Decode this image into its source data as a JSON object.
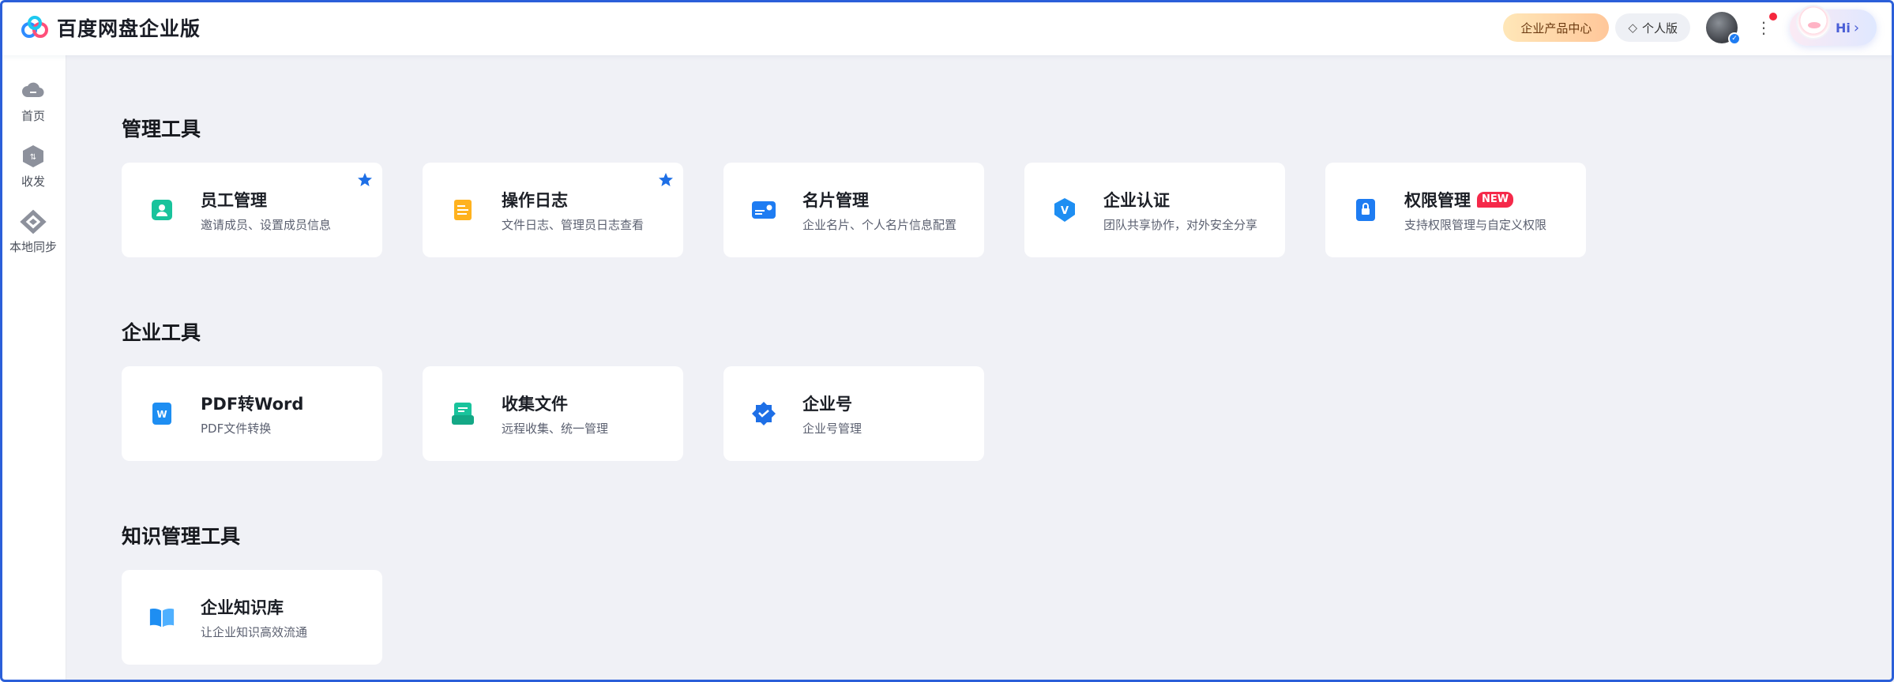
{
  "header": {
    "brand": "百度网盘企业版",
    "product_center": "企业产品中心",
    "personal_version": "个人版",
    "hi": "Hi"
  },
  "sidebar": {
    "items": [
      {
        "label": "首页",
        "icon": "cloud-icon"
      },
      {
        "label": "收发",
        "icon": "transfer-icon"
      },
      {
        "label": "本地同步",
        "icon": "sync-icon"
      }
    ]
  },
  "sections": [
    {
      "title": "管理工具",
      "cards": [
        {
          "title": "员工管理",
          "desc": "邀请成员、设置成员信息",
          "starred": true,
          "icon": "employee-icon",
          "color": "#19c39c"
        },
        {
          "title": "操作日志",
          "desc": "文件日志、管理员日志查看",
          "starred": true,
          "icon": "log-icon",
          "color": "#ffb21e"
        },
        {
          "title": "名片管理",
          "desc": "企业名片、个人名片信息配置",
          "starred": false,
          "icon": "card-icon",
          "color": "#1e7cf2"
        },
        {
          "title": "企业认证",
          "desc": "团队共享协作，对外安全分享",
          "starred": false,
          "icon": "verify-icon",
          "color": "#1e8ef2"
        },
        {
          "title": "权限管理",
          "desc": "支持权限管理与自定义权限",
          "starred": false,
          "icon": "lock-icon",
          "color": "#1e7cf2",
          "badge": "NEW"
        }
      ]
    },
    {
      "title": "企业工具",
      "cards": [
        {
          "title": "PDF转Word",
          "desc": "PDF文件转换",
          "starred": false,
          "icon": "pdf-word-icon",
          "color": "#1e8ef2"
        },
        {
          "title": "收集文件",
          "desc": "远程收集、统一管理",
          "starred": false,
          "icon": "collect-icon",
          "color": "#19c39c"
        },
        {
          "title": "企业号",
          "desc": "企业号管理",
          "starred": false,
          "icon": "enterprise-badge-icon",
          "color": "#1e6fe6"
        }
      ]
    },
    {
      "title": "知识管理工具",
      "cards": [
        {
          "title": "企业知识库",
          "desc": "让企业知识高效流通",
          "starred": false,
          "icon": "book-icon",
          "color": "#1e8ef2"
        }
      ]
    }
  ]
}
